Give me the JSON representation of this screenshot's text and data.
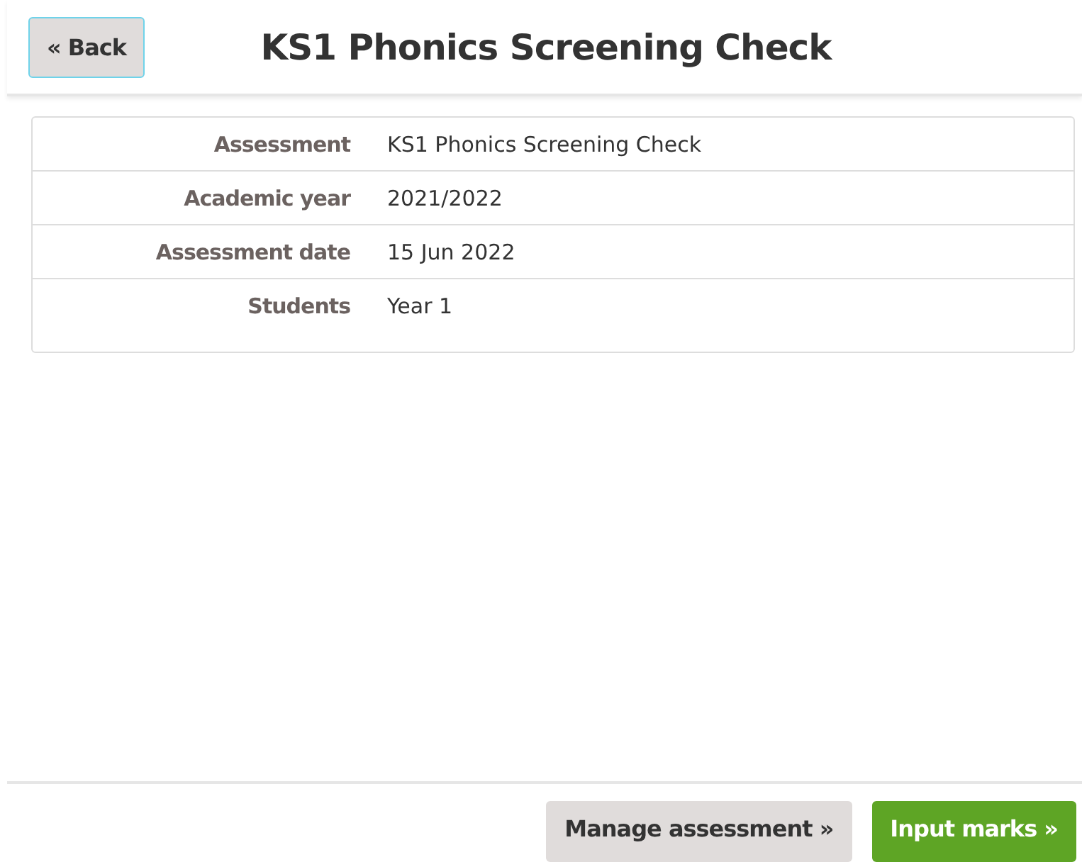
{
  "back_button": "« Back",
  "title": "KS1 Phonics Screening Check",
  "details": [
    {
      "label": "Assessment",
      "value": "KS1 Phonics Screening Check"
    },
    {
      "label": "Academic year",
      "value": "2021/2022"
    },
    {
      "label": "Assessment date",
      "value": "15 Jun 2022"
    },
    {
      "label": "Students",
      "value": "Year 1"
    }
  ],
  "buttons": [
    {
      "label": "Manage assessment »",
      "kind": "secondary"
    },
    {
      "label": "Input marks »",
      "kind": "primary"
    }
  ]
}
